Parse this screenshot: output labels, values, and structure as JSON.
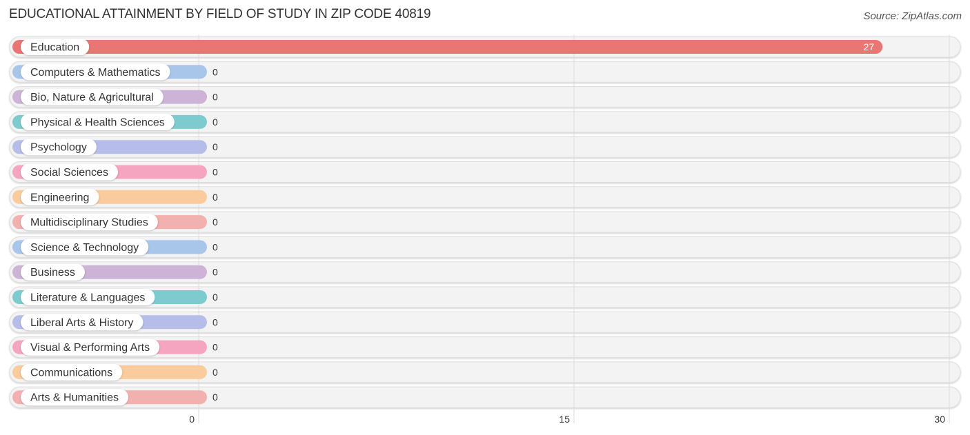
{
  "header": {
    "title": "EDUCATIONAL ATTAINMENT BY FIELD OF STUDY IN ZIP CODE 40819",
    "source": "Source: ZipAtlas.com"
  },
  "chart_data": {
    "type": "bar",
    "orientation": "horizontal",
    "title": "EDUCATIONAL ATTAINMENT BY FIELD OF STUDY IN ZIP CODE 40819",
    "xlabel": "",
    "ylabel": "",
    "xlim": [
      0,
      30
    ],
    "xticks": [
      0,
      15,
      30
    ],
    "grid": true,
    "categories": [
      "Education",
      "Computers & Mathematics",
      "Bio, Nature & Agricultural",
      "Physical & Health Sciences",
      "Psychology",
      "Social Sciences",
      "Engineering",
      "Multidisciplinary Studies",
      "Science & Technology",
      "Business",
      "Literature & Languages",
      "Liberal Arts & History",
      "Visual & Performing Arts",
      "Communications",
      "Arts & Humanities"
    ],
    "values": [
      27,
      0,
      0,
      0,
      0,
      0,
      0,
      0,
      0,
      0,
      0,
      0,
      0,
      0,
      0
    ],
    "colors": [
      "#e87672",
      "#a8c5ea",
      "#cdb3d6",
      "#7ecbcf",
      "#b6bde9",
      "#f5a5c0",
      "#f9cb9d",
      "#f2b0ae",
      "#a8c5ea",
      "#cdb3d6",
      "#7ecbcf",
      "#b6bde9",
      "#f5a5c0",
      "#f9cb9d",
      "#f2b0ae"
    ]
  }
}
